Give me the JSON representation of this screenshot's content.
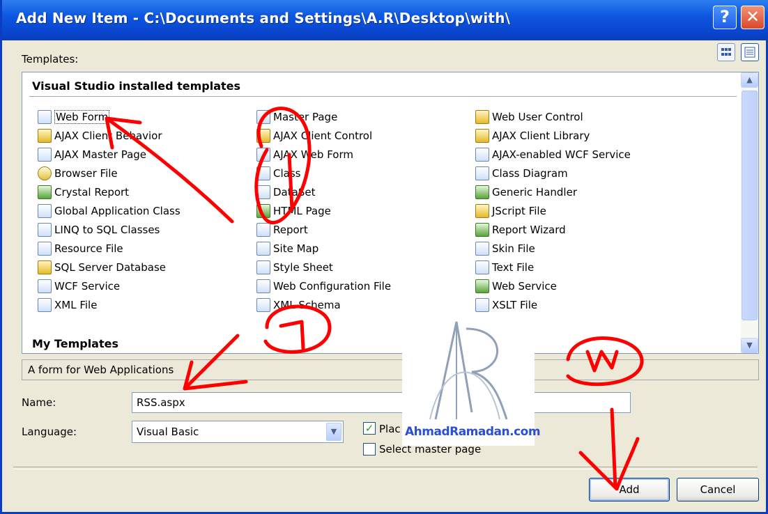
{
  "window": {
    "title": "Add New Item - C:\\Documents and Settings\\A.R\\Desktop\\with\\",
    "help_glyph": "?",
    "close_glyph": "✕"
  },
  "templates_label": "Templates:",
  "view_buttons": [
    {
      "name": "large-icons-view",
      "icon": "large-icons-view-icon"
    },
    {
      "name": "small-icons-view",
      "icon": "small-icons-view-icon",
      "selected": true
    }
  ],
  "groups": {
    "installed": "Visual Studio installed templates",
    "my": "My Templates"
  },
  "columns": [
    [
      {
        "label": "Web Form",
        "icon": "web-form-icon",
        "selected": true
      },
      {
        "label": "AJAX Client Behavior",
        "icon": "ajax-client-behavior-icon"
      },
      {
        "label": "AJAX Master Page",
        "icon": "ajax-master-page-icon"
      },
      {
        "label": "Browser File",
        "icon": "browser-file-icon"
      },
      {
        "label": "Crystal Report",
        "icon": "crystal-report-icon"
      },
      {
        "label": "Global Application Class",
        "icon": "global-application-class-icon"
      },
      {
        "label": "LINQ to SQL Classes",
        "icon": "linq-to-sql-classes-icon"
      },
      {
        "label": "Resource File",
        "icon": "resource-file-icon"
      },
      {
        "label": "SQL Server Database",
        "icon": "sql-server-database-icon"
      },
      {
        "label": "WCF Service",
        "icon": "wcf-service-icon"
      },
      {
        "label": "XML File",
        "icon": "xml-file-icon"
      }
    ],
    [
      {
        "label": "Master Page",
        "icon": "master-page-icon"
      },
      {
        "label": "AJAX Client Control",
        "icon": "ajax-client-control-icon"
      },
      {
        "label": "AJAX Web Form",
        "icon": "ajax-web-form-icon"
      },
      {
        "label": "Class",
        "icon": "class-icon"
      },
      {
        "label": "DataSet",
        "icon": "dataset-icon"
      },
      {
        "label": "HTML Page",
        "icon": "html-page-icon"
      },
      {
        "label": "Report",
        "icon": "report-icon"
      },
      {
        "label": "Site Map",
        "icon": "site-map-icon"
      },
      {
        "label": "Style Sheet",
        "icon": "style-sheet-icon"
      },
      {
        "label": "Web Configuration File",
        "icon": "web-configuration-file-icon"
      },
      {
        "label": "XML Schema",
        "icon": "xml-schema-icon"
      }
    ],
    [
      {
        "label": "Web User Control",
        "icon": "web-user-control-icon"
      },
      {
        "label": "AJAX Client Library",
        "icon": "ajax-client-library-icon"
      },
      {
        "label": "AJAX-enabled WCF Service",
        "icon": "ajax-enabled-wcf-service-icon"
      },
      {
        "label": "Class Diagram",
        "icon": "class-diagram-icon"
      },
      {
        "label": "Generic Handler",
        "icon": "generic-handler-icon"
      },
      {
        "label": "JScript File",
        "icon": "jscript-file-icon"
      },
      {
        "label": "Report Wizard",
        "icon": "report-wizard-icon"
      },
      {
        "label": "Skin File",
        "icon": "skin-file-icon"
      },
      {
        "label": "Text File",
        "icon": "text-file-icon"
      },
      {
        "label": "Web Service",
        "icon": "web-service-icon"
      },
      {
        "label": "XSLT File",
        "icon": "xslt-file-icon"
      }
    ]
  ],
  "description": "A form for Web Applications",
  "name_field": {
    "label": "Name:",
    "value": "RSS.aspx"
  },
  "language_field": {
    "label": "Language:",
    "value": "Visual Basic"
  },
  "checkboxes": {
    "place_code": {
      "label": "Plac",
      "checked": true
    },
    "select_master": {
      "label": "Select master page",
      "checked": false
    }
  },
  "buttons": {
    "add": "Add",
    "cancel": "Cancel"
  },
  "watermark": {
    "brand": "AhmadRamadan.com"
  },
  "annotation_color": "#ff0000"
}
